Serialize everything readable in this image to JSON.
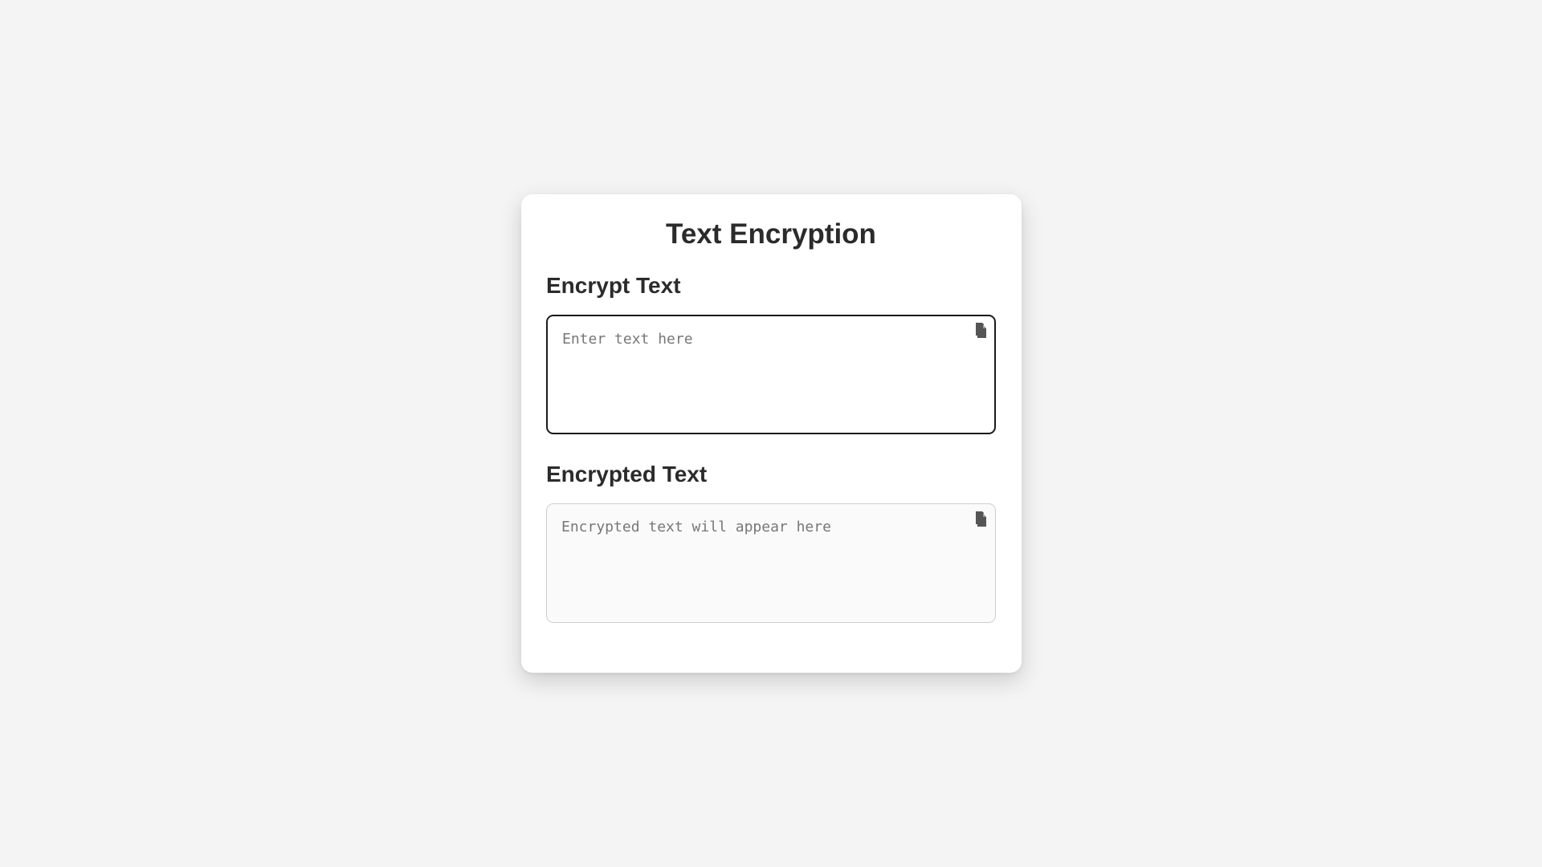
{
  "app": {
    "title": "Text Encryption"
  },
  "encrypt": {
    "label": "Encrypt Text",
    "value": "",
    "placeholder": "Enter text here",
    "copy_icon": "copy-icon"
  },
  "encrypted": {
    "label": "Encrypted Text",
    "value": "",
    "placeholder": "Encrypted text will appear here",
    "copy_icon": "copy-icon"
  },
  "colors": {
    "background": "#f4f4f4",
    "card": "#ffffff",
    "text": "#2b2b2b",
    "input_border": "#1a1a1a",
    "output_border": "#cfcfcf",
    "icon": "#555555"
  }
}
